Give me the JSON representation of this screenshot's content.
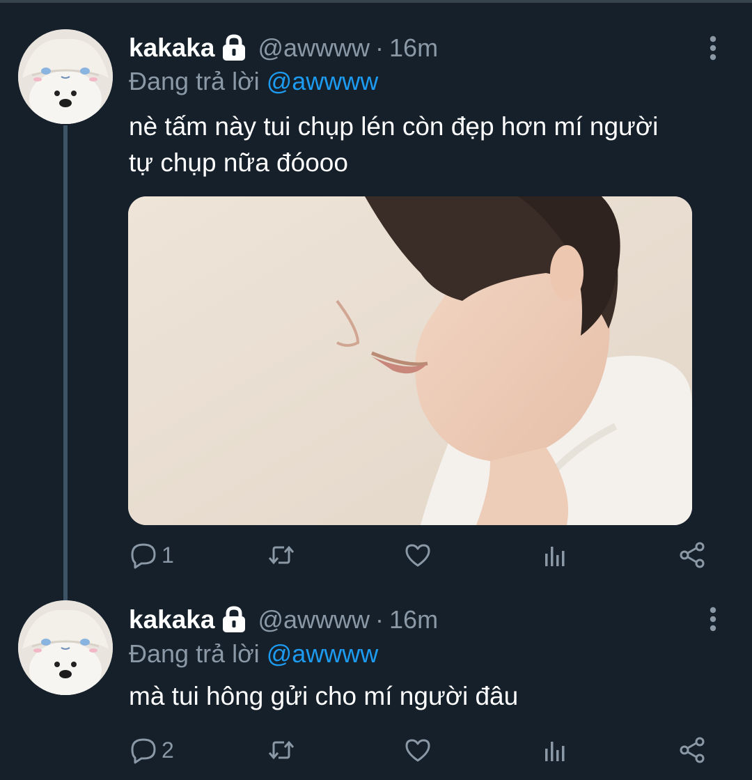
{
  "colors": {
    "background": "#15202b",
    "muted": "#8b98a5",
    "mention": "#1d9bf0",
    "thread_line": "#3d5466"
  },
  "tweets": [
    {
      "name": "kakaka",
      "handle": "@awwww",
      "separator": "·",
      "time": "16m",
      "reply_prefix": "Đang trả lời",
      "reply_to": "@awwww",
      "text": "nè tấm này tui chụp lén còn đẹp hơn mí người\ntự chụp nữa đóooo",
      "reply_count": "1",
      "has_media": true
    },
    {
      "name": "kakaka",
      "handle": "@awwww",
      "separator": "·",
      "time": "16m",
      "reply_prefix": "Đang trả lời",
      "reply_to": "@awwww",
      "text": "mà tui hông gửi cho mí người đâu",
      "reply_count": "2",
      "has_media": false
    }
  ],
  "icons": [
    "lock-icon",
    "more-icon",
    "reply-icon",
    "retweet-icon",
    "like-icon",
    "analytics-icon",
    "share-icon"
  ]
}
